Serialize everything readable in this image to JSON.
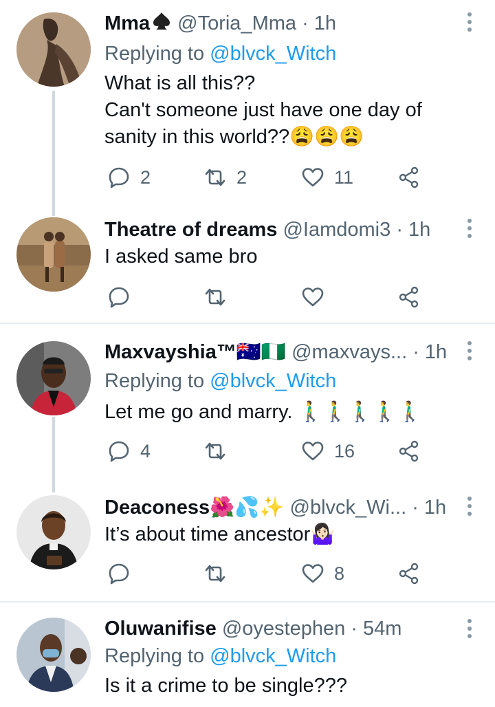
{
  "tweets": [
    {
      "name": "Mma",
      "handle": "@Toria_Mma",
      "time": "· 1h",
      "replying_prefix": "Replying to ",
      "replying_handle": "@blvck_Witch",
      "text_lines": [
        "What is all this??",
        "Can't someone just have one day of",
        "sanity in this world??😩😩😩"
      ],
      "reply_count": "2",
      "retweet_count": "2",
      "like_count": "11"
    },
    {
      "name": "Theatre of dreams",
      "handle": "@Iamdomi3",
      "time": "· 1h",
      "text_lines": [
        "I asked same bro"
      ],
      "reply_count": "",
      "retweet_count": "",
      "like_count": ""
    },
    {
      "name": "Maxvayshia™🇦🇺🇳🇬",
      "handle": "@maxvays...",
      "time": "· 1h",
      "replying_prefix": "Replying to ",
      "replying_handle": "@blvck_Witch",
      "text_lines": [
        "Let me go and marry. 🚶‍♂️🚶‍♂️🚶‍♂️🚶‍♂️🚶‍♂️"
      ],
      "reply_count": "4",
      "retweet_count": "",
      "like_count": "16"
    },
    {
      "name": "Deaconess🌺💦✨",
      "handle": "@blvck_Wi...",
      "time": "· 1h",
      "text_lines": [
        "It’s about time ancestor🤷🏻‍♀️"
      ],
      "reply_count": "",
      "retweet_count": "",
      "like_count": "8"
    },
    {
      "name": "Oluwanifise",
      "handle": "@oyestephen",
      "time": "· 54m",
      "replying_prefix": "Replying to ",
      "replying_handle": "@blvck_Witch",
      "text_lines": [
        "Is it a crime to be single???"
      ]
    }
  ],
  "icons": {
    "reply": "reply-icon",
    "retweet": "retweet-icon",
    "like": "heart-icon",
    "share": "share-icon",
    "more": "more-vertical-icon"
  },
  "colors": {
    "link": "#1d9bf0",
    "secondary": "#536471",
    "thread_line": "#cfd9de"
  }
}
